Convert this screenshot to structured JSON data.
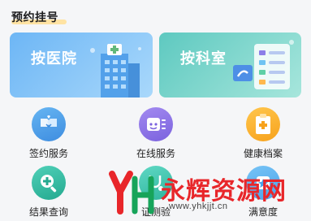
{
  "section": {
    "title": "预约挂号"
  },
  "banners": [
    {
      "label": "按医院"
    },
    {
      "label": "按科室"
    }
  ],
  "grid": [
    {
      "label": "签约服务",
      "icon": "handshake-icon"
    },
    {
      "label": "在线服务",
      "icon": "chat-service-icon"
    },
    {
      "label": "健康档案",
      "icon": "medical-record-icon"
    },
    {
      "label": "结果查询",
      "icon": "search-plus-icon"
    },
    {
      "label": "证测验",
      "icon": "stethoscope-icon"
    },
    {
      "label": "满意度",
      "icon": "rating-icon"
    }
  ],
  "watermark": {
    "brand": "永辉资源网",
    "url": "www.yhkjjt.cn"
  },
  "colors": {
    "accent_red": "#e8262a",
    "banner_blue": "#6db6f5",
    "banner_teal": "#5ec9c0"
  }
}
